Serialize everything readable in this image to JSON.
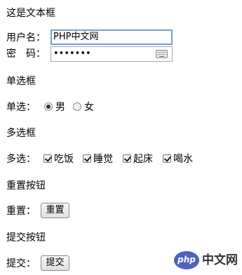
{
  "sections": {
    "text_fields": {
      "heading": "这是文本框"
    },
    "radio": {
      "heading": "单选框"
    },
    "checkbox": {
      "heading": "多选框"
    },
    "reset": {
      "heading": "重置按钮"
    },
    "submit": {
      "heading": "提交按钮"
    }
  },
  "form": {
    "username_label": "用户名：",
    "username_value": "PHP中文网",
    "password_label": "密　码：",
    "password_value": "•••••••",
    "radio_label": "单选：",
    "radio_options": [
      {
        "label": "男",
        "checked": true
      },
      {
        "label": "女",
        "checked": false
      }
    ],
    "checkbox_label": "多选：",
    "checkbox_options": [
      {
        "label": "吃饭",
        "checked": true
      },
      {
        "label": "睡觉",
        "checked": true
      },
      {
        "label": "起床",
        "checked": true
      },
      {
        "label": "喝水",
        "checked": true
      }
    ],
    "reset_label": "重置：",
    "reset_button": "重置",
    "submit_label": "提交：",
    "submit_button": "提交"
  },
  "watermark": {
    "logo_text": "php",
    "site_text": "中文网"
  }
}
